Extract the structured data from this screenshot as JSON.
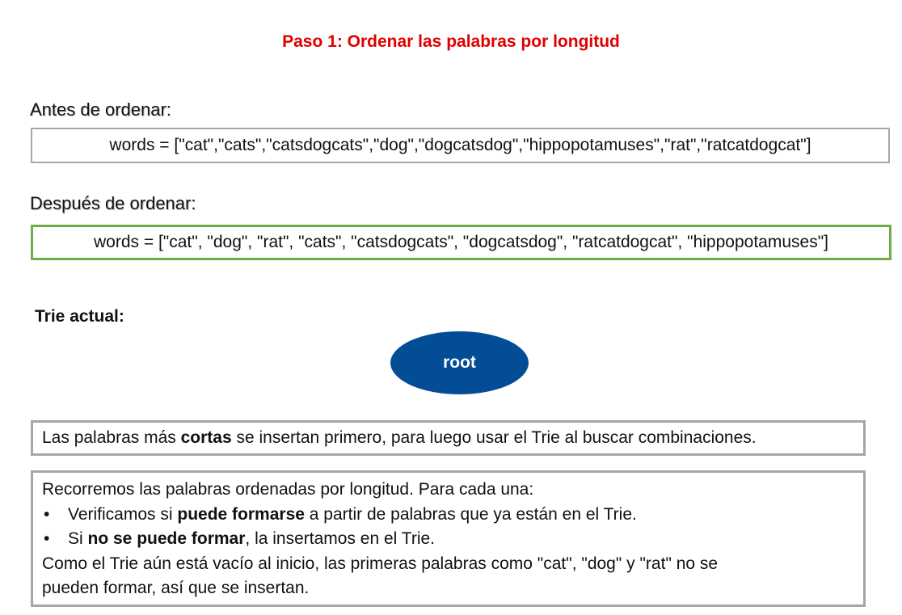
{
  "title": "Paso 1: Ordenar las palabras por longitud",
  "before": {
    "label": "Antes de ordenar:",
    "code": "words = [\"cat\",\"cats\",\"catsdogcats\",\"dog\",\"dogcatsdog\",\"hippopotamuses\",\"rat\",\"ratcatdogcat\"]"
  },
  "after": {
    "label": "Después de ordenar:",
    "code": "words = [\"cat\", \"dog\", \"rat\", \"cats\", \"catsdogcats\", \"dogcatsdog\", \"ratcatdogcat\", \"hippopotamuses\"]"
  },
  "trie": {
    "label": "Trie actual:",
    "root": "root"
  },
  "note": {
    "pre": "Las palabras más ",
    "bold": "cortas",
    "post": " se insertan primero, para luego usar el Trie al buscar combinaciones."
  },
  "steps": {
    "intro": "Recorremos las palabras ordenadas por longitud. Para cada una:",
    "bullet_symbol": "•",
    "bullet1": {
      "pre": "Verificamos si ",
      "bold": "puede formarse",
      "post": " a partir de palabras que ya están en el Trie."
    },
    "bullet2": {
      "pre": "Si ",
      "bold": "no se puede formar",
      "post": ", la insertamos en el Trie."
    },
    "closing1": "Como el Trie aún está vacío al inicio, las primeras palabras como \"cat\", \"dog\" y \"rat\" no se",
    "closing2": "pueden formar, así que se insertan."
  },
  "colors": {
    "title": "#e00000",
    "root_fill": "#034d96",
    "before_border": "#a6a6a6",
    "after_border": "#70ad47"
  }
}
